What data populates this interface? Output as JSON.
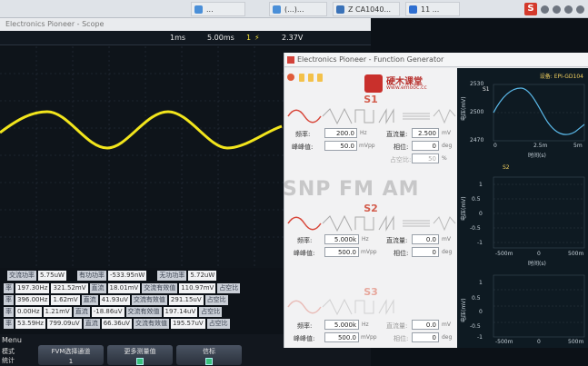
{
  "taskbar": {
    "tabs": [
      {
        "label": "..."
      },
      {
        "label": "(...)..."
      },
      {
        "label": "Z CA1040..."
      },
      {
        "label": "11 ..."
      }
    ]
  },
  "scope": {
    "title": "Electronics Pioneer - Scope",
    "time_div": "1ms",
    "time_pos": "5.00ms",
    "trigger_ch": "1",
    "trigger_level": "2.37V",
    "measurements": [
      {
        "label": "交流功率",
        "value": "5.75uW"
      },
      {
        "label": "有功功率",
        "value": "-533.95nW"
      },
      {
        "label": "无功功率",
        "value": "5.72uW"
      }
    ],
    "table_rows": [
      [
        "率",
        "197.30Hz",
        "321.52mV",
        "直流",
        "18.01mV",
        "交流有效值",
        "110.97mV",
        "占空比"
      ],
      [
        "率",
        "396.00Hz",
        "1.62mV",
        "直流",
        "41.93uV",
        "交流有效值",
        "291.15uV",
        "占空比"
      ],
      [
        "率",
        "0.00Hz",
        "1.21mV",
        "直流",
        "-18.86uV",
        "交流有效值",
        "197.14uV",
        "占空比"
      ],
      [
        "率",
        "53.59Hz",
        "799.09uV",
        "直流",
        "66.36uV",
        "交流有效值",
        "195.57uV",
        "占空比"
      ]
    ],
    "menu_label": "Menu",
    "menu_left": [
      "模式",
      "统计"
    ],
    "menu_buttons": [
      {
        "label": "FVM选择通道",
        "sub": "1"
      },
      {
        "label": "更多测量值",
        "sub": ""
      },
      {
        "label": "信标",
        "sub": ""
      }
    ]
  },
  "fg": {
    "title": "Electronics Pioneer - Function Generator",
    "logo_text": "硬木课堂",
    "logo_sub": "www.emooc.cc",
    "watermark": "SNP FM AM",
    "s1": {
      "title": "S1",
      "freq_label": "频率:",
      "freq": "200.0",
      "freq_unit": "Hz",
      "amp_label": "峰峰值:",
      "amp": "50.0",
      "amp_unit": "mVpp",
      "dc_label": "直流量:",
      "dc": "2.500",
      "dc_unit": "mV",
      "phase_label": "相位:",
      "phase": "0",
      "phase_unit": "deg",
      "duty_label": "占空比:",
      "duty": "50",
      "duty_unit": "%"
    },
    "s2": {
      "title": "S2",
      "freq_label": "频率:",
      "freq": "5.000k",
      "freq_unit": "Hz",
      "amp_label": "峰峰值:",
      "amp": "500.0",
      "amp_unit": "mVpp",
      "dc_label": "直流量:",
      "dc": "0.0",
      "dc_unit": "mV",
      "phase_label": "相位:",
      "phase": "0",
      "phase_unit": "deg"
    },
    "s3": {
      "title": "S3",
      "freq_label": "频率:",
      "freq": "5.000k",
      "freq_unit": "Hz",
      "amp_label": "峰峰值:",
      "amp": "500.0",
      "amp_unit": "mVpp",
      "dc_label": "直流量:",
      "dc": "0.0",
      "dc_unit": "mV",
      "phase_label": "相位:",
      "phase": "0",
      "phase_unit": "deg"
    },
    "right": {
      "device": "设备: EPI-GD104",
      "s1_label": "S1",
      "s2_label": "S2",
      "s1_y_ticks": [
        "2530",
        "2500",
        "2470"
      ],
      "s1_x_ticks": [
        "0",
        "2.5m",
        "5m"
      ],
      "time_label": "时间(s)",
      "voltage_label": "电压(mV)",
      "s2_y_ticks": [
        "1",
        "0.5",
        "0",
        "-0.5",
        "-1"
      ],
      "s2_x_ticks": [
        "-500m",
        "0",
        "500m"
      ],
      "s3_y_ticks": [
        "1",
        "0.5",
        "0",
        "-0.5",
        "-1"
      ],
      "s3_x_ticks": [
        "-500m",
        "0",
        "500m"
      ]
    }
  }
}
